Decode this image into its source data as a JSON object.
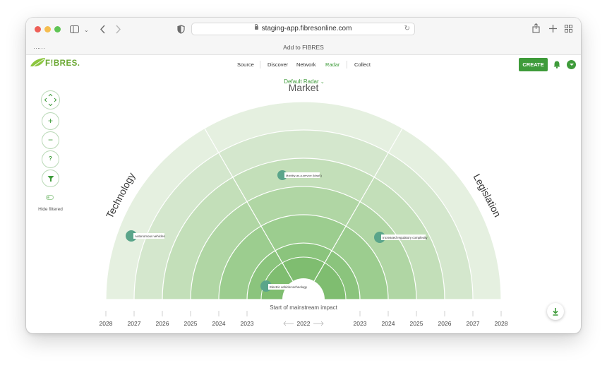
{
  "browser": {
    "url": "staging-app.fibresonline.com",
    "tab_title": "Add to FIBRES"
  },
  "app": {
    "logo_text": "F!BRES.",
    "nav": [
      {
        "label": "Source"
      },
      {
        "label": "Discover"
      },
      {
        "label": "Network"
      },
      {
        "label": "Radar",
        "active": true
      },
      {
        "label": "Collect"
      }
    ],
    "create_label": "CREATE"
  },
  "sidebar": {
    "hide_filtered_label": "Hide filtered",
    "help_label": "?"
  },
  "radar": {
    "selector_label": "Default Radar",
    "sectors": {
      "left": "Technology",
      "middle": "Market",
      "right": "Legislation"
    },
    "caption": "Start of mainstream impact",
    "center_year": "2022",
    "years_left": [
      "2028",
      "2027",
      "2026",
      "2025",
      "2024",
      "2023"
    ],
    "years_right": [
      "2023",
      "2024",
      "2025",
      "2026",
      "2027",
      "2028"
    ],
    "items": [
      {
        "label": "Autonomous vehicles"
      },
      {
        "label": "Mobility-as-a-service (MaaS)"
      },
      {
        "label": "Increased regulatory complexity"
      },
      {
        "label": "Electric vehicle technology"
      }
    ]
  },
  "colors": {
    "accent": "#3e9b3a",
    "dot": "#5aa58a"
  }
}
